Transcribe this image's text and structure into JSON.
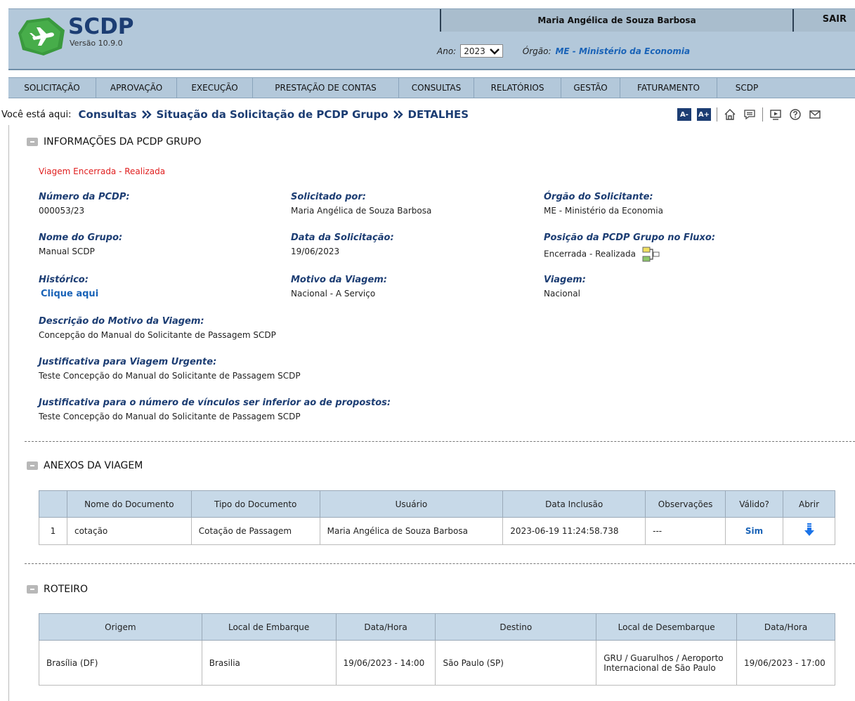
{
  "brand": {
    "name": "SCDP",
    "version": "Versão 10.9.0"
  },
  "user": {
    "name": "Maria Angélica de Souza Barbosa",
    "logout_label": "SAIR"
  },
  "filters": {
    "year_label": "Ano:",
    "year_value": "2023",
    "org_label": "Órgão:",
    "org_value": "ME - Ministério da Economia"
  },
  "menu": [
    "SOLICITAÇÃO",
    "APROVAÇÃO",
    "EXECUÇÃO",
    "PRESTAÇÃO DE CONTAS",
    "CONSULTAS",
    "RELATÓRIOS",
    "GESTÃO",
    "FATURAMENTO",
    "SCDP"
  ],
  "breadcrumb": {
    "label": "Você está aqui:",
    "items": [
      "Consultas",
      "Situação da Solicitação de PCDP Grupo",
      "DETALHES"
    ]
  },
  "tools": {
    "font_decrease": "A-",
    "font_increase": "A+",
    "icons": [
      "home-icon",
      "chat-icon",
      "video-icon",
      "help-icon",
      "mail-icon"
    ]
  },
  "info": {
    "title": "INFORMAÇÕES DA PCDP GRUPO",
    "status": "Viagem Encerrada - Realizada",
    "pcdp_number": {
      "label": "Número da PCDP:",
      "value": "000053/23"
    },
    "requested_by": {
      "label": "Solicitado por:",
      "value": "Maria Angélica de Souza Barbosa"
    },
    "requester_org": {
      "label": "Órgão do Solicitante:",
      "value": "ME - Ministério da Economia"
    },
    "group_name": {
      "label": "Nome do Grupo:",
      "value": "Manual SCDP"
    },
    "request_date": {
      "label": "Data da Solicitação:",
      "value": "19/06/2023"
    },
    "flow_position": {
      "label": "Posição da PCDP Grupo no Fluxo:",
      "value": "Encerrada - Realizada"
    },
    "history": {
      "label": "Histórico:",
      "value": "Clique aqui"
    },
    "trip_reason": {
      "label": "Motivo da Viagem:",
      "value": "Nacional - A Serviço"
    },
    "trip": {
      "label": "Viagem:",
      "value": "Nacional"
    },
    "reason_description": {
      "label": "Descrição do Motivo da Viagem:",
      "value": "Concepção do Manual do Solicitante de Passagem SCDP"
    },
    "urgent_justification": {
      "label": "Justificativa para Viagem Urgente:",
      "value": "Teste Concepção do Manual do Solicitante de Passagem SCDP"
    },
    "links_justification": {
      "label": "Justificativa para o número de vínculos ser inferior ao de propostos:",
      "value": "Teste Concepção do Manual do Solicitante de Passagem SCDP"
    }
  },
  "attachments": {
    "title": "ANEXOS DA VIAGEM",
    "headers": [
      "",
      "Nome do Documento",
      "Tipo do Documento",
      "Usuário",
      "Data Inclusão",
      "Observações",
      "Válido?",
      "Abrir"
    ],
    "rows": [
      {
        "index": "1",
        "name": "cotação",
        "type": "Cotação de Passagem",
        "user": "Maria Angélica de Souza Barbosa",
        "date": "2023-06-19 11:24:58.738",
        "notes": "---",
        "valid": "Sim"
      }
    ]
  },
  "itinerary": {
    "title": "ROTEIRO",
    "headers": [
      "Origem",
      "Local de Embarque",
      "Data/Hora",
      "Destino",
      "Local de Desembarque",
      "Data/Hora"
    ],
    "rows": [
      {
        "origin": "Brasília (DF)",
        "boarding": "Brasilia",
        "departure": "19/06/2023 - 14:00",
        "destination": "São Paulo (SP)",
        "landing": "GRU / Guarulhos / Aeroporto Internacional de São Paulo",
        "arrival": "19/06/2023 - 17:00"
      }
    ]
  }
}
